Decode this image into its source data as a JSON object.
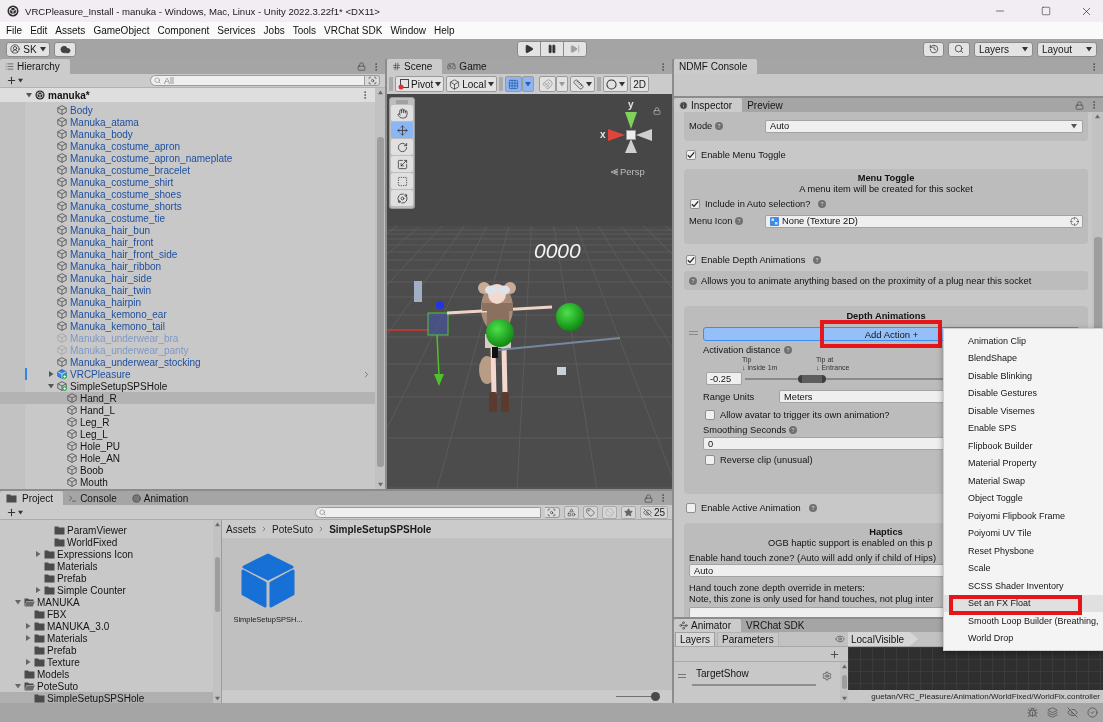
{
  "window": {
    "title": "VRCPleasure_Install - manuka - Windows, Mac, Linux - Unity 2022.3.22f1* <DX11>"
  },
  "menu_bar": [
    "File",
    "Edit",
    "Assets",
    "GameObject",
    "Component",
    "Services",
    "Jobs",
    "Tools",
    "VRChat SDK",
    "Window",
    "Help"
  ],
  "toolbar": {
    "account": "SK",
    "playback": [
      {
        "kind": "play",
        "disabled": false
      },
      {
        "kind": "pause",
        "disabled": false
      },
      {
        "kind": "step",
        "disabled": true
      }
    ],
    "layers": "Layers",
    "layout": "Layout"
  },
  "hierarchy": {
    "tab": "Hierarchy",
    "search": {
      "placeholder": "All"
    },
    "scene": {
      "name": "manuka*",
      "expanded": true
    },
    "rows": [
      {
        "name": "Body",
        "kind": "prefab",
        "active": true,
        "selected": false
      },
      {
        "name": "Manuka_atama",
        "kind": "prefab",
        "active": true,
        "selected": false
      },
      {
        "name": "Manuka_body",
        "kind": "prefab",
        "active": true,
        "selected": false
      },
      {
        "name": "Manuka_costume_apron",
        "kind": "prefab",
        "active": true,
        "selected": false
      },
      {
        "name": "Manuka_costume_apron_nameplate",
        "kind": "prefab",
        "active": true,
        "selected": false
      },
      {
        "name": "Manuka_costume_bracelet",
        "kind": "prefab",
        "active": true,
        "selected": false
      },
      {
        "name": "Manuka_costume_shirt",
        "kind": "prefab",
        "active": true,
        "selected": false
      },
      {
        "name": "Manuka_costume_shoes",
        "kind": "prefab",
        "active": true,
        "selected": false
      },
      {
        "name": "Manuka_costume_shorts",
        "kind": "prefab",
        "active": true,
        "selected": false
      },
      {
        "name": "Manuka_costume_tie",
        "kind": "prefab",
        "active": true,
        "selected": false
      },
      {
        "name": "Manuka_hair_bun",
        "kind": "prefab",
        "active": true,
        "selected": false
      },
      {
        "name": "Manuka_hair_front",
        "kind": "prefab",
        "active": true,
        "selected": false
      },
      {
        "name": "Manuka_hair_front_side",
        "kind": "prefab",
        "active": true,
        "selected": false
      },
      {
        "name": "Manuka_hair_ribbon",
        "kind": "prefab",
        "active": true,
        "selected": false
      },
      {
        "name": "Manuka_hair_side",
        "kind": "prefab",
        "active": true,
        "selected": false
      },
      {
        "name": "Manuka_hair_twin",
        "kind": "prefab",
        "active": true,
        "selected": false
      },
      {
        "name": "Manuka_hairpin",
        "kind": "prefab",
        "active": true,
        "selected": false
      },
      {
        "name": "Manuka_kemono_ear",
        "kind": "prefab",
        "active": true,
        "selected": false
      },
      {
        "name": "Manuka_kemono_tail",
        "kind": "prefab",
        "active": true,
        "selected": false
      },
      {
        "name": "Manuka_underwear_bra",
        "kind": "prefab",
        "active": false,
        "selected": false
      },
      {
        "name": "Manuka_underwear_panty",
        "kind": "prefab",
        "active": false,
        "selected": false
      },
      {
        "name": "Manuka_underwear_stocking",
        "kind": "prefab",
        "active": true,
        "selected": false
      },
      {
        "name": "VRCPleasure",
        "kind": "prefab-added",
        "active": true,
        "selected": false,
        "expanded": false
      },
      {
        "name": "SimpleSetupSPSHole",
        "kind": "added",
        "active": true,
        "selected": false,
        "expanded": true,
        "children": [
          {
            "name": "Hand_R",
            "kind": "object",
            "active": true,
            "selected": true
          },
          {
            "name": "Hand_L",
            "kind": "object",
            "active": true,
            "selected": false
          },
          {
            "name": "Leg_R",
            "kind": "object",
            "active": true,
            "selected": false
          },
          {
            "name": "Leg_L",
            "kind": "object",
            "active": true,
            "selected": false
          },
          {
            "name": "Hole_PU",
            "kind": "object",
            "active": true,
            "selected": false
          },
          {
            "name": "Hole_AN",
            "kind": "object",
            "active": true,
            "selected": false
          },
          {
            "name": "Boob",
            "kind": "object",
            "active": true,
            "selected": false
          },
          {
            "name": "Mouth",
            "kind": "object",
            "active": true,
            "selected": false
          }
        ]
      }
    ]
  },
  "scene": {
    "tabs": [
      {
        "label": "Scene",
        "selected": true
      },
      {
        "label": "Game",
        "selected": false
      }
    ],
    "toolbar": {
      "pivot": "Pivot",
      "space": "Local",
      "grid_snap": {
        "on": true
      },
      "mode_2d": "2D"
    },
    "tools": [
      {
        "kind": "hand",
        "selected": false
      },
      {
        "kind": "move",
        "selected": true
      },
      {
        "kind": "rotate",
        "selected": false
      },
      {
        "kind": "scale",
        "selected": false
      },
      {
        "kind": "rect",
        "selected": false
      },
      {
        "kind": "transform",
        "selected": false
      }
    ],
    "gizmo": {
      "x_label": "x",
      "y_label": "y"
    },
    "projection": "Persp",
    "counter": "0000"
  },
  "ndmf_console": {
    "tab": "NDMF Console"
  },
  "inspector": {
    "tabs": [
      {
        "label": "Inspector",
        "selected": true
      },
      {
        "label": "Preview",
        "selected": false
      }
    ],
    "mode": {
      "label": "Mode",
      "value": "Auto"
    },
    "enable_menu_toggle": {
      "label": "Enable Menu Toggle",
      "checked": true
    },
    "menu_toggle": {
      "title": "Menu Toggle",
      "description": "A menu item will be created for this socket",
      "include_in_auto": {
        "label": "Include in Auto selection?",
        "checked": true
      },
      "menu_icon": {
        "label": "Menu Icon",
        "value": "None (Texture 2D)"
      }
    },
    "enable_depth_animations": {
      "label": "Enable Depth Animations",
      "checked": true
    },
    "depth_help": "Allows you to animate anything based on the proximity of a plug near this socket",
    "depth_animations": {
      "title": "Depth Animations",
      "add_action": {
        "label": "Add Action +",
        "active": true,
        "callout": true
      },
      "activation": {
        "label": "Activation distance",
        "value": "-0.25",
        "marks": [
          {
            "title": "Tip",
            "caption": "↓ inside 1m"
          },
          {
            "title": "Tip at",
            "caption": "↓ Entrance"
          }
        ],
        "level": 0.2
      },
      "range_units": {
        "label": "Range Units",
        "value": "Meters"
      },
      "allow_self": {
        "label": "Allow avatar to trigger its own animation?",
        "checked": false
      },
      "smoothing": {
        "label": "Smoothing Seconds",
        "value": "0"
      },
      "reverse_clip": {
        "label": "Reverse clip (unusual)",
        "checked": false
      }
    },
    "enable_active_animation": {
      "label": "Enable Active Animation",
      "checked": false
    },
    "haptics": {
      "title": "Haptics",
      "note": "OGB haptic support is enabled on this p",
      "hand_touch": {
        "label": "Enable hand touch zone? (Auto will add only if child of Hips)",
        "value": "Auto"
      },
      "depth_override": {
        "label": "Hand touch zone depth override in meters:",
        "note": "Note, this zone is only used for hand touches, not plug inter"
      }
    }
  },
  "add_action_menu": {
    "items": [
      {
        "label": "Animation Clip",
        "selected": false,
        "callout": false
      },
      {
        "label": "BlendShape",
        "selected": false,
        "callout": false
      },
      {
        "label": "Disable Blinking",
        "selected": false,
        "callout": false
      },
      {
        "label": "Disable Gestures",
        "selected": false,
        "callout": false
      },
      {
        "label": "Disable Visemes",
        "selected": false,
        "callout": false
      },
      {
        "label": "Enable SPS",
        "selected": false,
        "callout": false
      },
      {
        "label": "Flipbook Builder",
        "selected": false,
        "callout": false
      },
      {
        "label": "Material Property",
        "selected": false,
        "callout": false
      },
      {
        "label": "Material Swap",
        "selected": false,
        "callout": false
      },
      {
        "label": "Object Toggle",
        "selected": false,
        "callout": false
      },
      {
        "label": "Poiyomi Flipbook Frame",
        "selected": false,
        "callout": false
      },
      {
        "label": "Poiyomi UV Tile",
        "selected": false,
        "callout": false
      },
      {
        "label": "Reset Physbone",
        "selected": false,
        "callout": false
      },
      {
        "label": "Scale",
        "selected": false,
        "callout": false
      },
      {
        "label": "SCSS Shader Inventory",
        "selected": false,
        "callout": false
      },
      {
        "label": "Set an FX Float",
        "selected": true,
        "callout": true
      },
      {
        "label": "Smooth Loop Builder (Breathing,",
        "selected": false,
        "callout": false
      },
      {
        "label": "World Drop",
        "selected": false,
        "callout": false
      }
    ]
  },
  "animator": {
    "tabs": [
      {
        "label": "Animator",
        "selected": true
      },
      {
        "label": "VRChat SDK",
        "selected": false
      }
    ],
    "sub_tabs": [
      {
        "label": "Layers",
        "selected": true
      },
      {
        "label": "Parameters",
        "selected": false
      }
    ],
    "breadcrumb": "LocalVisible",
    "layers": [
      {
        "name": "TargetShow"
      }
    ],
    "path": "guetan/VRC_Pleasure/Animation/WorldFixed/WorldFix.controller"
  },
  "project": {
    "tabs": [
      {
        "label": "Project",
        "selected": true
      },
      {
        "label": "Console",
        "selected": false
      },
      {
        "label": "Animation",
        "selected": false
      }
    ],
    "hidden_count": "25",
    "tree": [
      {
        "children": [
          {
            "children": [
              {
                "children": [
                  {
                    "name": "ParamViewer",
                    "selected": false
                  },
                  {
                    "name": "WorldFixed",
                    "selected": false
                  }
                ]
              },
              {
                "name": "Expressions Icon",
                "selected": false,
                "expanded": false
              },
              {
                "name": "Materials",
                "selected": false
              },
              {
                "name": "Prefab",
                "selected": false
              },
              {
                "name": "Simple Counter",
                "selected": false,
                "expanded": false
              }
            ]
          }
        ]
      },
      {
        "name": "MANUKA",
        "selected": false,
        "expanded": true,
        "children": [
          {
            "name": "FBX",
            "selected": false
          },
          {
            "name": "MANUKA_3.0",
            "selected": false,
            "expanded": false
          },
          {
            "name": "Materials",
            "selected": false,
            "expanded": false
          },
          {
            "name": "Prefab",
            "selected": false
          },
          {
            "name": "Texture",
            "selected": false,
            "expanded": false
          }
        ]
      },
      {
        "name": "Models",
        "selected": false
      },
      {
        "name": "PoteSuto",
        "selected": false,
        "expanded": true,
        "children": [
          {
            "name": "SimpleSetupSPSHole",
            "selected": true
          }
        ]
      }
    ],
    "breadcrumb": [
      "Assets",
      "PoteSuto",
      "SimpleSetupSPSHole"
    ],
    "assets": [
      {
        "name": "SimpleSetupSPSH...",
        "selected": false
      }
    ],
    "zoom_slider": {
      "level": 1
    }
  }
}
